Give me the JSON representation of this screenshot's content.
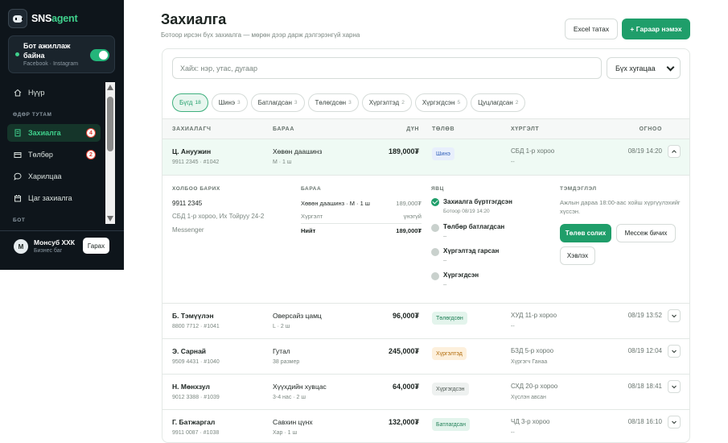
{
  "brand": {
    "prefix": "SNS",
    "accent": "agent"
  },
  "bot_status": {
    "title": "Бот ажиллаж байна",
    "platforms": "Facebook · Instagram",
    "enabled": true
  },
  "nav": {
    "home": "Нүүр",
    "section_daily": "ӨДӨР ТУТАМ",
    "orders": "Захиалга",
    "orders_badge": "4",
    "payments": "Төлбөр",
    "payments_badge": "2",
    "chats": "Харилцаа",
    "appointments": "Цаг захиалга",
    "section_bot": "БОТ"
  },
  "user": {
    "initial": "М",
    "name": "Монсуб ХХК",
    "role": "Бизнес баг",
    "logout": "Гарах"
  },
  "header": {
    "title": "Захиалга",
    "subtitle": "Ботоор ирсэн бүх захиалга — мөрөн дээр дарж дэлгэрэнгүй харна",
    "excel_button": "Excel татах",
    "manual_button": "+ Гараар нэмэх"
  },
  "filters": {
    "search_placeholder": "Хайх: нэр, утас, дугаар",
    "time_select": "Бүх хугацаа",
    "chips": [
      {
        "label": "Бүгд",
        "count": "18"
      },
      {
        "label": "Шинэ",
        "count": "3"
      },
      {
        "label": "Батлагдсан",
        "count": "3"
      },
      {
        "label": "Төлөгдсөн",
        "count": "3"
      },
      {
        "label": "Хүргэлтэд",
        "count": "2"
      },
      {
        "label": "Хүргэгдсэн",
        "count": "5"
      },
      {
        "label": "Цуцлагдсан",
        "count": "2"
      }
    ]
  },
  "columns": {
    "customer": "ЗАХИАЛАГЧ",
    "product": "БАРАА",
    "amount": "ДҮН",
    "status": "ТӨЛӨВ",
    "delivery": "ХҮРГЭЛТ",
    "date": "ОГНОО"
  },
  "orders": [
    {
      "name": "Ц. Ануужин",
      "meta": "9911 2345 · #1042",
      "product": "Хөвөн даашинз",
      "variant": "M · 1 ш",
      "amount": "189,000₮",
      "status": "Шинэ",
      "address": "СБД 1-р хороо",
      "driver": "--",
      "date": "08/19 14:20"
    },
    {
      "name": "Б. Тэмүүлэн",
      "meta": "8800 7712 · #1041",
      "product": "Оверсайз цамц",
      "variant": "L · 2 ш",
      "amount": "96,000₮",
      "status": "Төлөгдсөн",
      "address": "ХУД 11-р хороо",
      "driver": "--",
      "date": "08/19 13:52"
    },
    {
      "name": "Э. Сарнай",
      "meta": "9509 4431 · #1040",
      "product": "Гутал",
      "variant": "38 размер",
      "amount": "245,000₮",
      "status": "Хүргэлтэд",
      "address": "БЗД 5-р хороо",
      "driver": "Хүргэгч Ганаа",
      "date": "08/19 12:04"
    },
    {
      "name": "Н. Мөнхзул",
      "meta": "9012 3388 · #1039",
      "product": "Хүүхдийн хувцас",
      "variant": "3-4 нас · 2 ш",
      "amount": "64,000₮",
      "status": "Хүргэгдсэн",
      "address": "СХД 20-р хороо",
      "driver": "Хүслэн авсан",
      "date": "08/18 18:41"
    },
    {
      "name": "Г. Батжаргал",
      "meta": "9911 0087 · #1038",
      "product": "Савхин цүнх",
      "variant": "Хар · 1 ш",
      "amount": "132,000₮",
      "status": "Батлагдсан",
      "address": "ЧД 3-р хороо",
      "driver": "--",
      "date": "08/18 16:10"
    }
  ],
  "detail": {
    "contact_header": "ХОЛБОО БАРИХ",
    "phone": "9911 2345",
    "address": "СБД 1-р хороо, Их Тойруу 24-2",
    "channel": "Messenger",
    "product_header": "БАРАА",
    "line_item": "Хөвөн даашинз · M · 1 ш",
    "line_amount": "189,000₮",
    "delivery_label": "Хүргэлт",
    "delivery_value": "үнэгүй",
    "total_label": "Нийт",
    "total_value": "189,000₮",
    "progress_header": "ЯВЦ",
    "steps": [
      {
        "title": "Захиалга бүртгэгдсэн",
        "sub": "Ботоор 08/19 14:20",
        "done": true
      },
      {
        "title": "Төлбөр батлагдсан",
        "sub": "--",
        "done": false
      },
      {
        "title": "Хүргэлтэд гарсан",
        "sub": "--",
        "done": false
      },
      {
        "title": "Хүргэгдсэн",
        "sub": "--",
        "done": false
      }
    ],
    "note_header": "ТЭМДЭГЛЭЛ",
    "note": "Ажлын дараа 18:00-аас хойш хүргүүлэхийг хүссэн.",
    "btn_status": "Төлөв солих",
    "btn_message": "Мессеж бичих",
    "btn_cancel": "Хэвлэх"
  },
  "colors": {
    "accent": "#1f9e6a",
    "sidebar": "#0e151b",
    "selected_row": "#effaf4"
  }
}
